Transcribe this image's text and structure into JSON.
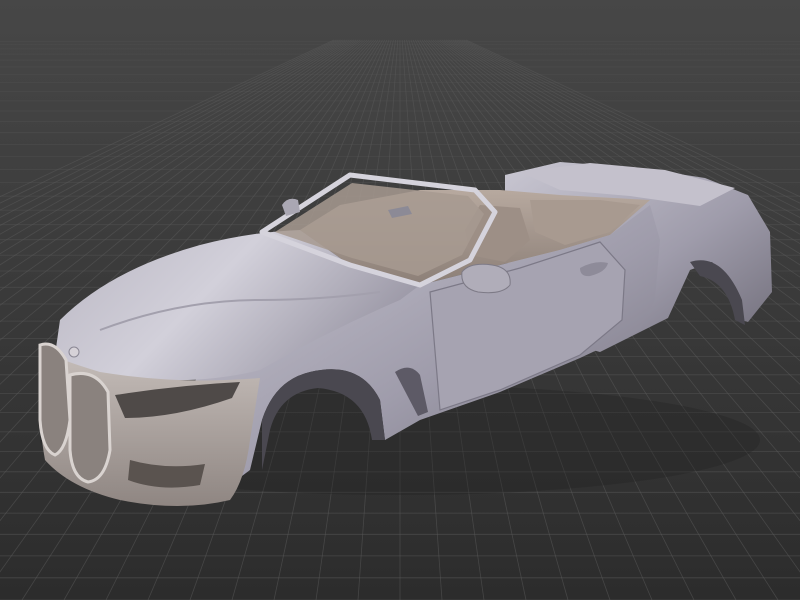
{
  "viewport": {
    "background_top": "#474747",
    "background_bottom": "#2c2c2c",
    "grid_color": "#5a5a5a"
  },
  "model": {
    "body_light": "#c9c7d2",
    "body_mid": "#9f9cab",
    "body_dark": "#6f6c78",
    "interior_color": "#b7a99f",
    "interior_shadow": "#8c7f77",
    "trim_color": "#d8d2cf"
  }
}
